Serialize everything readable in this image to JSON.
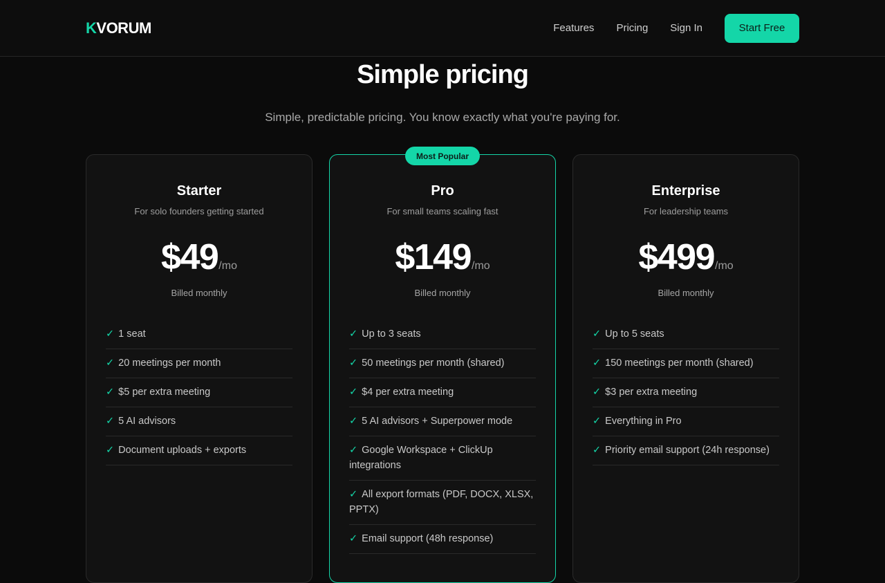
{
  "brand": {
    "logo_mark": "K",
    "logo_rest": "VORUM"
  },
  "nav": {
    "links": [
      "Features",
      "Pricing",
      "Sign In"
    ],
    "cta": "Start Free"
  },
  "hero": {
    "title": "Simple pricing",
    "subtitle": "Simple, predictable pricing. You know exactly what you're paying for."
  },
  "colors": {
    "accent": "#14d6a8",
    "background": "#0b0b0b",
    "card": "#121212"
  },
  "check_glyph": "✓",
  "plans": [
    {
      "name": "Starter",
      "desc": "For solo founders getting started",
      "price": "$49",
      "period": "/mo",
      "billing": "Billed monthly",
      "features": [
        "1 seat",
        "20 meetings per month",
        "$5 per extra meeting",
        "5 AI advisors",
        "Document uploads + exports"
      ]
    },
    {
      "name": "Pro",
      "badge": "Most Popular",
      "desc": "For small teams scaling fast",
      "price": "$149",
      "period": "/mo",
      "billing": "Billed monthly",
      "features": [
        "Up to 3 seats",
        "50 meetings per month (shared)",
        "$4 per extra meeting",
        "5 AI advisors + Superpower mode",
        "Google Workspace + ClickUp integrations",
        "All export formats (PDF, DOCX, XLSX, PPTX)",
        "Email support (48h response)"
      ]
    },
    {
      "name": "Enterprise",
      "desc": "For leadership teams",
      "price": "$499",
      "period": "/mo",
      "billing": "Billed monthly",
      "features": [
        "Up to 5 seats",
        "150 meetings per month (shared)",
        "$3 per extra meeting",
        "Everything in Pro",
        "Priority email support (24h response)"
      ]
    }
  ]
}
